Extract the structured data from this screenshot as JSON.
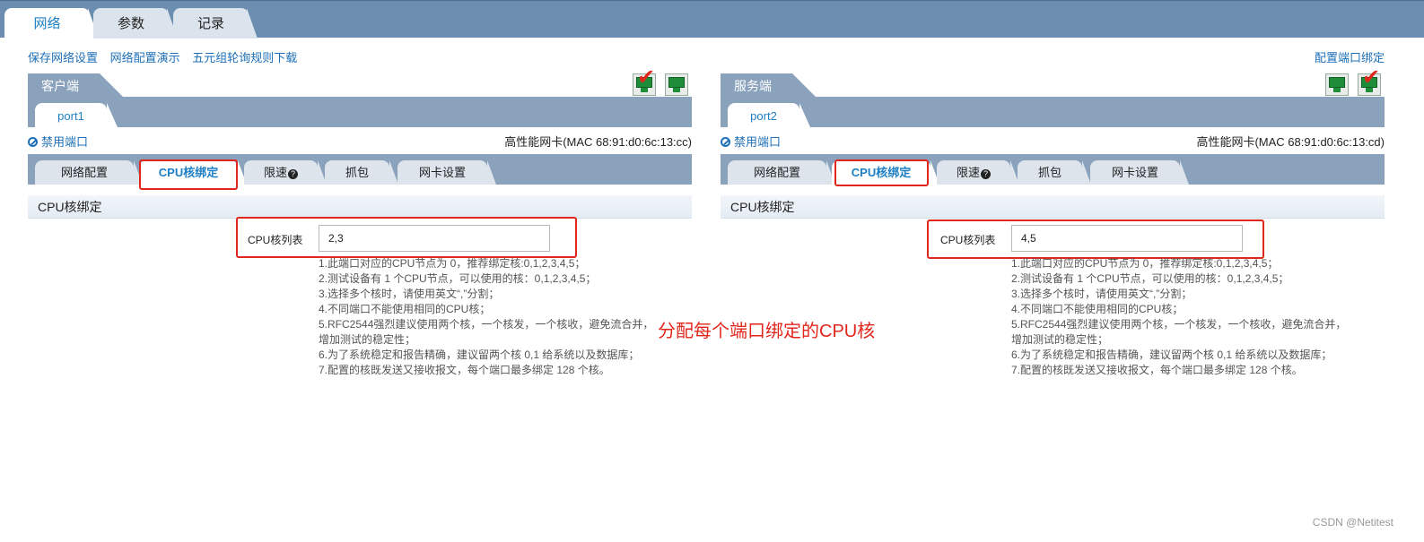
{
  "top_tabs": [
    "网络",
    "参数",
    "记录"
  ],
  "links": {
    "save": "保存网络设置",
    "demo": "网络配置演示",
    "download": "五元组轮询规则下载",
    "bind_port": "配置端口绑定"
  },
  "client": {
    "title": "客户端",
    "port": "port1",
    "disable": "禁用端口",
    "nic": "高性能网卡(MAC 68:91:d0:6c:13:cc)",
    "cpu_list_label": "CPU核列表",
    "cpu_list_value": "2,3"
  },
  "server": {
    "title": "服务端",
    "port": "port2",
    "disable": "禁用端口",
    "nic": "高性能网卡(MAC 68:91:d0:6c:13:cd)",
    "cpu_list_label": "CPU核列表",
    "cpu_list_value": "4,5"
  },
  "sub_tabs": {
    "net_config": "网络配置",
    "cpu_bind": "CPU核绑定",
    "rate_limit": "限速",
    "capture": "抓包",
    "nic_settings": "网卡设置"
  },
  "section_title": "CPU核绑定",
  "notes": "1.此端口对应的CPU节点为 0，推荐绑定核:0,1,2,3,4,5；\n2.测试设备有 1 个CPU节点，可以使用的核：0,1,2,3,4,5；\n3.选择多个核时，请使用英文“,”分割；\n4.不同端口不能使用相同的CPU核；\n5.RFC2544强烈建议使用两个核，一个核发，一个核收，避免流合并，增加测试的稳定性；\n6.为了系统稳定和报告精确，建议留两个核 0,1 给系统以及数据库；\n7.配置的核既发送又接收报文，每个端口最多绑定 128 个核。",
  "annotation": "分配每个端口绑定的CPU核",
  "watermark": "CSDN @Netitest",
  "colors": {
    "accent": "#1e7fc4",
    "tab_bar": "#8aa2bc",
    "header": "#6a8db0",
    "highlight": "#e1261c"
  }
}
